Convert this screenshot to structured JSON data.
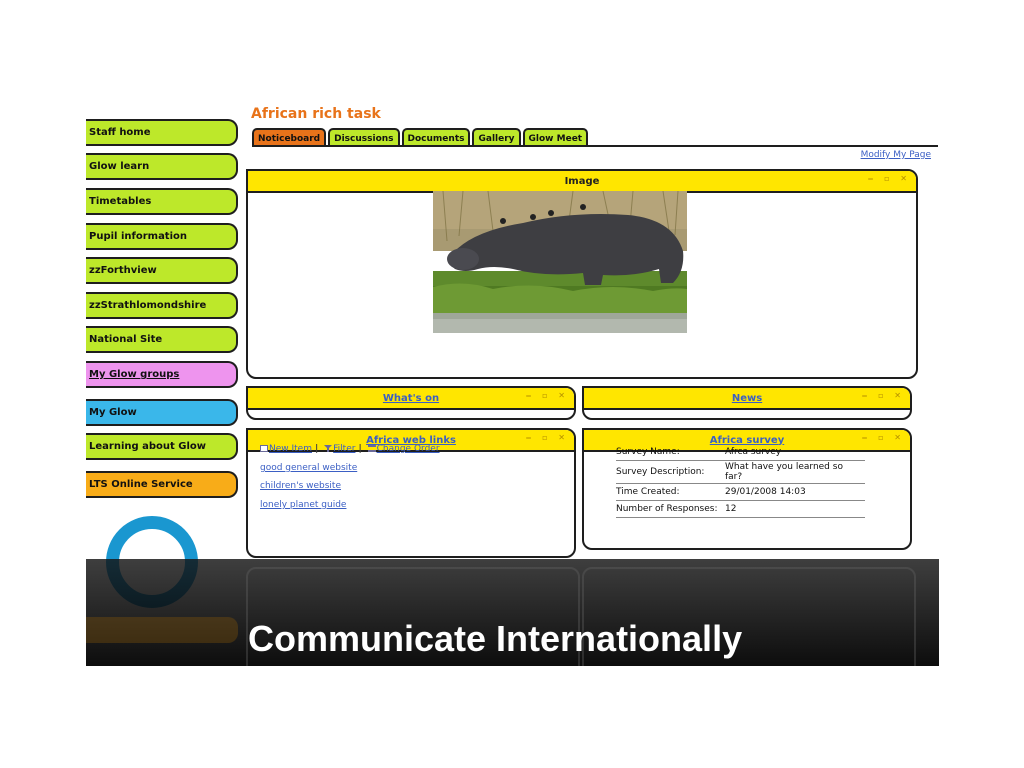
{
  "sidebar": {
    "items": [
      {
        "label": "Staff home"
      },
      {
        "label": "Glow learn"
      },
      {
        "label": "Timetables"
      },
      {
        "label": "Pupil information"
      },
      {
        "label": "zzForthview"
      },
      {
        "label": "zzStrathlomondshire"
      },
      {
        "label": "National Site"
      },
      {
        "label": "My Glow groups"
      },
      {
        "label": "My Glow"
      },
      {
        "label": "Learning about Glow"
      },
      {
        "label": "LTS Online Service"
      }
    ],
    "logo_icon": "glow-ring-logo"
  },
  "header": {
    "title": "African rich task",
    "tabs": [
      {
        "label": "Noticeboard"
      },
      {
        "label": "Discussions"
      },
      {
        "label": "Documents"
      },
      {
        "label": "Gallery"
      },
      {
        "label": "Glow Meet"
      }
    ],
    "active_tab": "Noticeboard",
    "modify_link": "Modify My Page"
  },
  "parts": {
    "image": {
      "title": "Image",
      "picture": "hippo-photo"
    },
    "whats_on": {
      "title": "What's on"
    },
    "news": {
      "title": "News"
    },
    "links": {
      "title": "Africa web links",
      "toolbar": {
        "new_item": "New Item",
        "filter": "Filter",
        "change_order": "Change Order"
      },
      "items": [
        {
          "label": "good general website"
        },
        {
          "label": "children's website"
        },
        {
          "label": "lonely planet guide"
        }
      ]
    },
    "survey": {
      "title": "Africa survey",
      "rows": [
        {
          "key": "Survey Name:",
          "value": "Afrca survey"
        },
        {
          "key": "Survey Description:",
          "value": "What have you learned so far?"
        },
        {
          "key": "Time Created:",
          "value": "29/01/2008 14:03"
        },
        {
          "key": "Number of Responses:",
          "value": "12"
        }
      ]
    }
  },
  "caption": "Communicate Internationally",
  "colors": {
    "nav_green": "#bde82a",
    "nav_pink": "#ee94ee",
    "nav_blue": "#3ab7ea",
    "nav_orange": "#f8ac18",
    "accent_orange": "#e8731a",
    "header_yellow": "#ffe600",
    "link_blue": "#3b5fc4"
  }
}
